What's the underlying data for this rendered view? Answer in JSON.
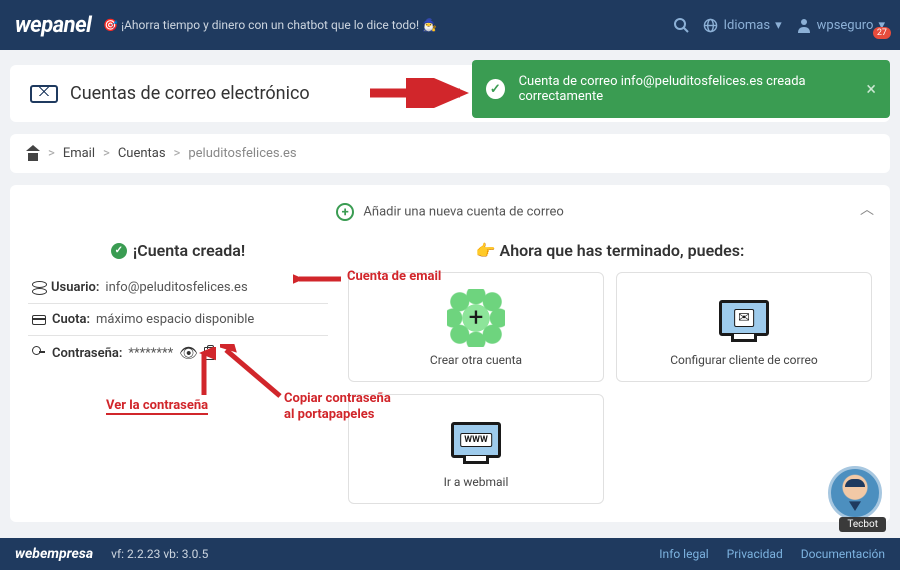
{
  "header": {
    "logo": "wepanel",
    "promo": "🎯 ¡Ahorra tiempo y dinero con un chatbot que lo dice todo! 🧙‍♂️",
    "lang_label": "Idiomas",
    "user_label": "wpseguro",
    "badge": "27"
  },
  "page_header": {
    "title": "Cuentas de correo electrónico"
  },
  "toast": {
    "text": "Cuenta de correo info@peluditosfelices.es creada correctamente"
  },
  "breadcrumb": {
    "items": [
      "Email",
      "Cuentas"
    ],
    "current": "peluditosfelices.es",
    "sep": ">"
  },
  "add_row": {
    "label": "Añadir una nueva cuenta de correo"
  },
  "left": {
    "heading": "¡Cuenta creada!",
    "user_label": "Usuario:",
    "user_value": "info@peluditosfelices.es",
    "quota_label": "Cuota:",
    "quota_value": "máximo espacio disponible",
    "pass_label": "Contraseña:",
    "pass_value": "********"
  },
  "right": {
    "heading": "👉 Ahora que has terminado, puedes:",
    "cards": {
      "create": "Crear otra cuenta",
      "config": "Configurar cliente de correo",
      "webmail": "Ir a webmail"
    }
  },
  "annotations": {
    "email": "Cuenta de email",
    "see_pass": "Ver la contraseña",
    "copy_pass1": "Copiar contraseña",
    "copy_pass2": "al portapapeles"
  },
  "bot": {
    "label": "Tecbot"
  },
  "footer": {
    "brand": "webempresa",
    "version": "vf: 2.2.23 vb: 3.0.5",
    "links": {
      "legal": "Info legal",
      "privacy": "Privacidad",
      "docs": "Documentación"
    }
  }
}
